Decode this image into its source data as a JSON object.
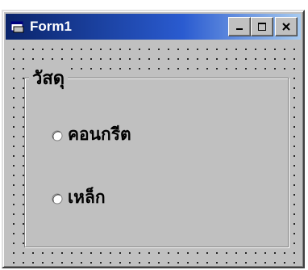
{
  "window": {
    "title": "Form1",
    "icon": "form-icon",
    "buttons": [
      "minimize-icon",
      "maximize-icon",
      "close-icon"
    ]
  },
  "frame": {
    "caption": "วัสดุ"
  },
  "options": [
    {
      "label": "คอนกรีต",
      "selected": false
    },
    {
      "label": "เหล็ก",
      "selected": false
    }
  ],
  "colors": {
    "face": "#c0c0c0",
    "title_start": "#0a246a",
    "title_end": "#a6caf0"
  }
}
